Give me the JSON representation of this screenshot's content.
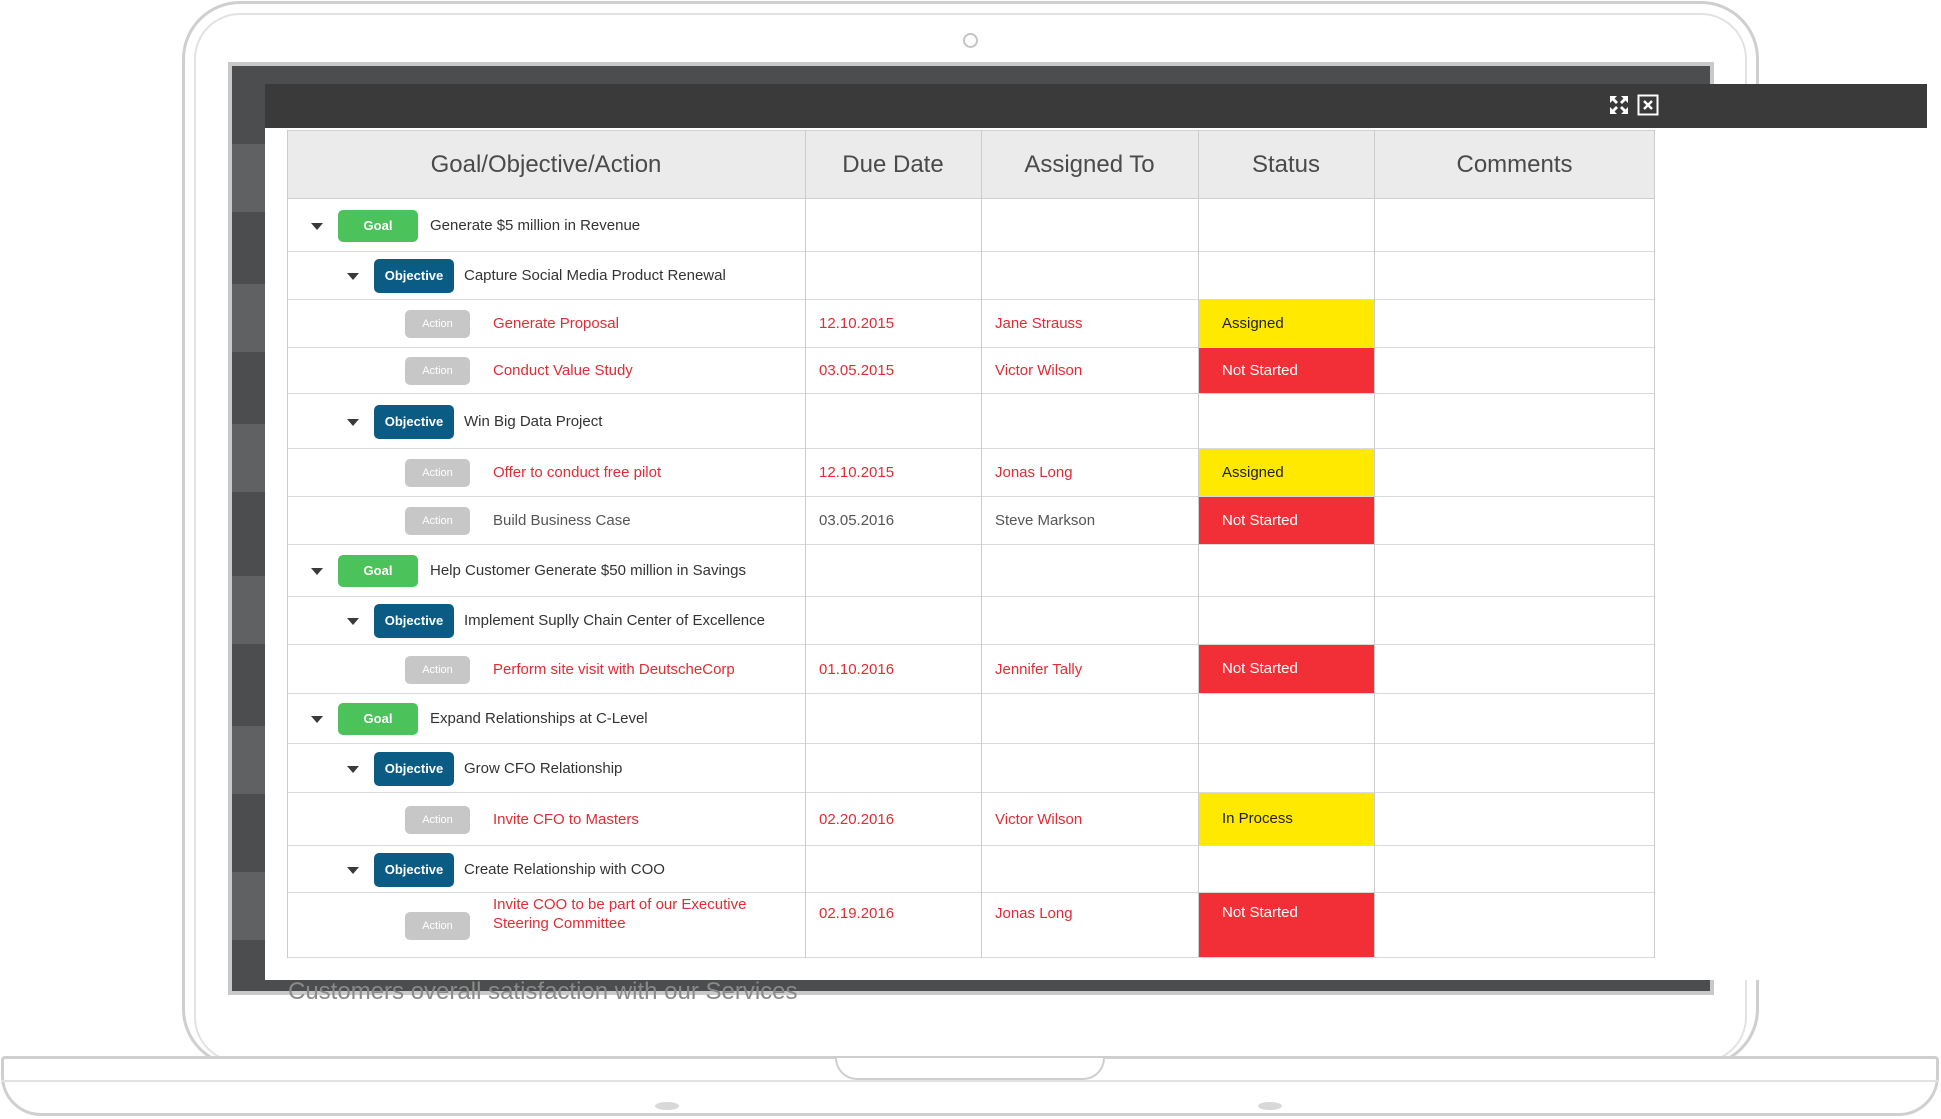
{
  "modal": {
    "toolbar": {
      "expand_icon": "expand-icon",
      "close_icon": "close-icon"
    }
  },
  "background": {
    "partial_text": "Customers overall satisfaction with our Services"
  },
  "table": {
    "headers": [
      "Goal/Objective/Action",
      "Due Date",
      "Assigned To",
      "Status",
      "Comments"
    ],
    "rows": [
      {
        "level": "goal",
        "tag": "Goal",
        "label": "Generate $5 million in Revenue"
      },
      {
        "level": "objective",
        "tag": "Objective",
        "label": "Capture Social Media Product Renewal"
      },
      {
        "level": "action",
        "tag": "Action",
        "label": "Generate Proposal",
        "due": "12.10.2015",
        "assignee": "Jane Strauss",
        "status": "Assigned",
        "status_color": "#ffe900",
        "highlight": true
      },
      {
        "level": "action",
        "tag": "Action",
        "label": "Conduct Value Study",
        "due": "03.05.2015",
        "assignee": "Victor Wilson",
        "status": "Not Started",
        "status_color": "#f22e36",
        "highlight": true
      },
      {
        "level": "objective",
        "tag": "Objective",
        "label": "Win Big Data Project"
      },
      {
        "level": "action",
        "tag": "Action",
        "label": "Offer to conduct free pilot",
        "due": "12.10.2015",
        "assignee": "Jonas Long",
        "status": "Assigned",
        "status_color": "#ffe900",
        "highlight": true
      },
      {
        "level": "action",
        "tag": "Action",
        "label": "Build Business Case",
        "due": "03.05.2016",
        "assignee": "Steve Markson",
        "status": "Not Started",
        "status_color": "#f22e36",
        "highlight": false
      },
      {
        "level": "goal",
        "tag": "Goal",
        "label": "Help Customer Generate $50 million in Savings"
      },
      {
        "level": "objective",
        "tag": "Objective",
        "label": "Implement Suplly Chain Center of Excellence"
      },
      {
        "level": "action",
        "tag": "Action",
        "label": "Perform site visit with DeutscheCorp",
        "due": "01.10.2016",
        "assignee": "Jennifer Tally",
        "status": "Not Started",
        "status_color": "#f22e36",
        "highlight": true
      },
      {
        "level": "goal",
        "tag": "Goal",
        "label": "Expand Relationships at C-Level"
      },
      {
        "level": "objective",
        "tag": "Objective",
        "label": "Grow CFO Relationship"
      },
      {
        "level": "action",
        "tag": "Action",
        "label": "Invite CFO to Masters",
        "due": "02.20.2016",
        "assignee": "Victor Wilson",
        "status": "In Process",
        "status_color": "#ffe900",
        "highlight": true
      },
      {
        "level": "objective",
        "tag": "Objective",
        "label": "Create Relationship with COO"
      },
      {
        "level": "action",
        "tag": "Action",
        "label": "Invite COO to be part of our Executive",
        "label2": "Steering Committee",
        "due": "02.19.2016",
        "assignee": "Jonas Long",
        "status": "Not Started",
        "status_color": "#f22e36",
        "highlight": true
      }
    ]
  },
  "colors": {
    "goal": "#4cc25b",
    "objective": "#0a5c85",
    "action": "#c7c7c7",
    "highlight_text": "#e22b35"
  }
}
